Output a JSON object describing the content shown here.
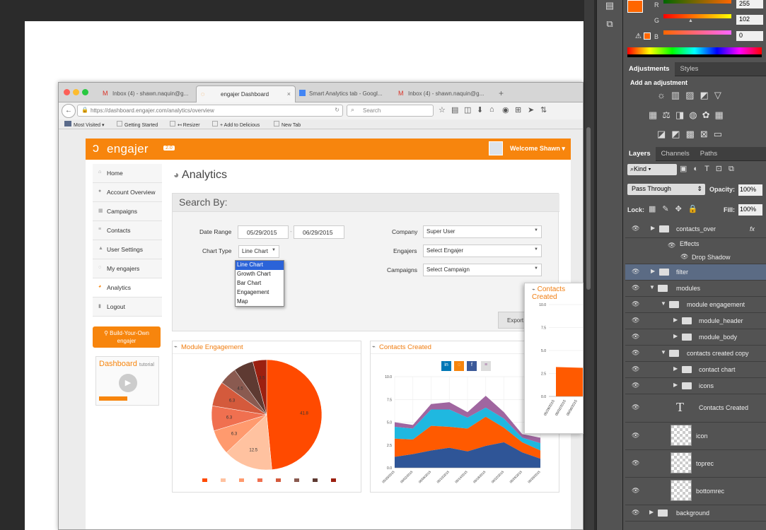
{
  "browser": {
    "tabs": [
      {
        "label": "Inbox (4) - shawn.naquin@g...",
        "icon": "gmail-icon"
      },
      {
        "label": "engajer Dashboard",
        "icon": "engajer-icon"
      },
      {
        "label": "Smart Analytics tab - Googl...",
        "icon": "docs-icon"
      },
      {
        "label": "Inbox (4) - shawn.naquin@g...",
        "icon": "gmail-icon"
      }
    ],
    "url": "https://dashboard.engajer.com/analytics/overview",
    "search_placeholder": "Search",
    "bookmarks": [
      "Most Visited",
      "Getting Started",
      "↤ Resizer",
      "+ Add to Delicious",
      "New Tab"
    ]
  },
  "app": {
    "logo": "engajer",
    "version": "2.0",
    "welcome": "Welcome Shawn",
    "sidebar": [
      "Home",
      "Account Overview",
      "Campaigns",
      "Contacts",
      "User Settings",
      "My engajers",
      "Analytics",
      "Logout"
    ],
    "build_button": [
      "Build-Your-Own",
      "engajer"
    ],
    "tutorial_title": "Dashboard",
    "tutorial_sub": "tutorial",
    "page_title": "Analytics",
    "search_by": "Search By:",
    "date_range_label": "Date Range",
    "date_from": "05/29/2015",
    "date_to": "06/29/2015",
    "chart_type_label": "Chart Type",
    "chart_type_value": "Line Chart",
    "chart_type_options": [
      "Line Chart",
      "Growth Chart",
      "Bar Chart",
      "Engagement",
      "Map"
    ],
    "company_label": "Company",
    "company_value": "Super User",
    "engajers_label": "Engajers",
    "engajers_value": "Select Engajer",
    "campaigns_label": "Campaigns",
    "campaigns_value": "Select Campaign",
    "export_label": "Export",
    "module_engagement_title": "Module Engagement",
    "contacts_created_title": "Contacts Created"
  },
  "chart_data": [
    {
      "type": "pie",
      "title": "Module Engagement",
      "values": [
        41.8,
        12.5,
        6.3,
        6.3,
        6.3,
        4.5,
        5,
        3.5
      ],
      "labels": [
        "41.8",
        "12.5",
        "6.3",
        "6.3",
        "6.3",
        "4.5",
        "",
        "3.5"
      ],
      "colors": [
        "#ff4a00",
        "#ffc2a0",
        "#ff9a6e",
        "#f07050",
        "#d45a3c",
        "#8a5a50",
        "#5e3a32",
        "#9c2010"
      ]
    },
    {
      "type": "area",
      "title": "Contacts Created",
      "ylim": [
        0,
        10
      ],
      "yticks": [
        "0.0",
        "2.5",
        "5.0",
        "7.5",
        "10.0"
      ],
      "categories": [
        "05/29/2015",
        "06/02/2015",
        "06/06/2015",
        "06/10/2015",
        "06/14/2015",
        "06/18/2015",
        "06/22/2015",
        "06/26/2015",
        "06/29/2015"
      ],
      "series": [
        {
          "values": [
            1.2,
            1.5,
            1.9,
            2.2,
            1.8,
            2.4,
            2.8,
            1.7,
            1.0
          ],
          "color": "#2f5597"
        },
        {
          "values": [
            2.0,
            1.6,
            2.7,
            2.3,
            2.5,
            3.2,
            1.6,
            1.1,
            0.9
          ],
          "color": "#ff5a00"
        },
        {
          "values": [
            1.3,
            1.2,
            1.8,
            1.9,
            1.2,
            1.0,
            1.0,
            0.5,
            0.8
          ],
          "color": "#1fb8e0"
        },
        {
          "values": [
            0.5,
            0.4,
            0.6,
            0.8,
            0.6,
            1.3,
            0.7,
            0.4,
            0.6
          ],
          "color": "#a066a0"
        }
      ]
    }
  ],
  "photoshop": {
    "color": {
      "r_label": "R",
      "g_label": "G",
      "b_label": "B",
      "r": "255",
      "g": "102",
      "b": "0",
      "swatch": "#ff6600"
    },
    "adjustments_tab": "Adjustments",
    "styles_tab": "Styles",
    "add_adjustment": "Add an adjustment",
    "layers_tab": "Layers",
    "channels_tab": "Channels",
    "paths_tab": "Paths",
    "kind": "Kind",
    "blend_mode": "Pass Through",
    "opacity_label": "Opacity:",
    "opacity": "100%",
    "lock_label": "Lock:",
    "fill_label": "Fill:",
    "fill": "100%",
    "layers": [
      "contacts_over",
      "Effects",
      "Drop Shadow",
      "filter",
      "modules",
      "module engagement",
      "module_header",
      "module_body",
      "contacts created copy",
      "contact chart",
      "icons",
      "Contacts Created",
      "icon",
      "toprec",
      "bottomrec",
      "background"
    ]
  }
}
